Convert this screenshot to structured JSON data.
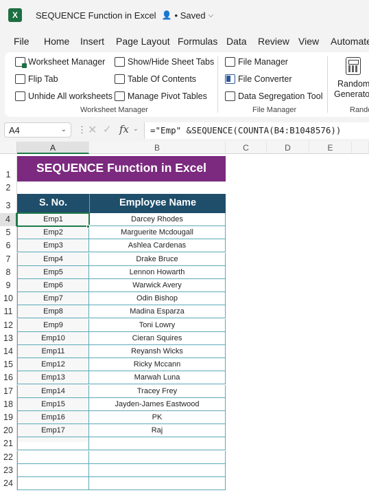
{
  "titlebar": {
    "app_icon": "X",
    "title": "SEQUENCE Function in Excel",
    "collab_icon": "person-icon",
    "status": "• Saved",
    "chevron": "⌵"
  },
  "menu": [
    "File",
    "Home",
    "Insert",
    "Page Layout",
    "Formulas",
    "Data",
    "Review",
    "View",
    "Automate"
  ],
  "ribbon": {
    "worksheet_manager": {
      "items": [
        "Worksheet Manager",
        "Flip Tab",
        "Unhide All worksheets",
        "Show/Hide Sheet Tabs",
        "Table Of Contents",
        "Manage Pivot Tables"
      ],
      "label": "Worksheet Manager"
    },
    "file_manager": {
      "items": [
        "File Manager",
        "File Converter",
        "Data Segregation Tool"
      ],
      "label": "File Manager"
    },
    "random": {
      "line1": "Random",
      "line2": "Generator",
      "label": "Random"
    }
  },
  "formula_bar": {
    "name_box": "A4",
    "fx": "fx",
    "formula": "=\"Emp\" &SEQUENCE(COUNTA(B4:B1048576))"
  },
  "grid": {
    "columns": [
      "A",
      "B",
      "C",
      "D",
      "E"
    ],
    "rows": [
      "1",
      "2",
      "3",
      "4",
      "5",
      "6",
      "7",
      "8",
      "9",
      "10",
      "11",
      "12",
      "13",
      "14",
      "15",
      "16",
      "17",
      "18",
      "19",
      "20",
      "21",
      "22",
      "23",
      "24"
    ],
    "title": "SEQUENCE Function in Excel",
    "headers": [
      "S. No.",
      "Employee Name"
    ],
    "data": [
      [
        "Emp1",
        "Darcey Rhodes"
      ],
      [
        "Emp2",
        "Marguerite Mcdougall"
      ],
      [
        "Emp3",
        "Ashlea Cardenas"
      ],
      [
        "Emp4",
        "Drake Bruce"
      ],
      [
        "Emp5",
        "Lennon Howarth"
      ],
      [
        "Emp6",
        "Warwick Avery"
      ],
      [
        "Emp7",
        "Odin Bishop"
      ],
      [
        "Emp8",
        "Madina Esparza"
      ],
      [
        "Emp9",
        "Toni Lowry"
      ],
      [
        "Emp10",
        "Cieran Squires"
      ],
      [
        "Emp11",
        "Reyansh Wicks"
      ],
      [
        "Emp12",
        "Ricky Mccann"
      ],
      [
        "Emp13",
        "Marwah Luna"
      ],
      [
        "Emp14",
        "Tracey Frey"
      ],
      [
        "Emp15",
        "Jayden-James Eastwood"
      ],
      [
        "Emp16",
        "PK"
      ],
      [
        "Emp17",
        "Raj"
      ]
    ]
  },
  "colors": {
    "title_fill": "#7b2a7f",
    "header_fill": "#1f4e6b",
    "border": "#5aa9b9",
    "selection": "#1f7a48"
  }
}
